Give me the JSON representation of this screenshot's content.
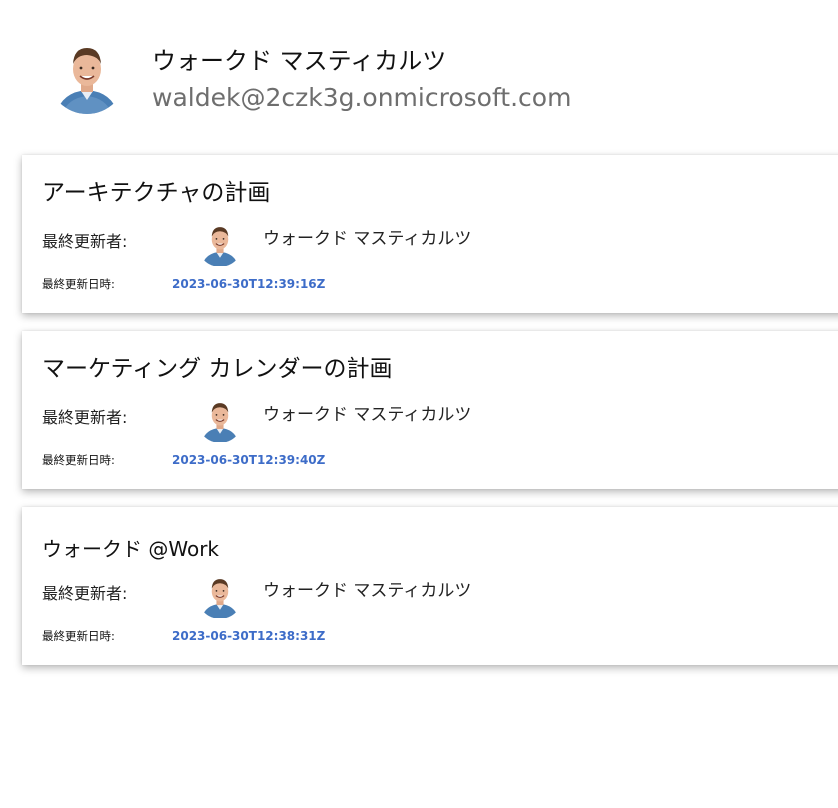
{
  "profile": {
    "name": "ウォークド マスティカルツ",
    "email": "waldek@2czk3g.onmicrosoft.com",
    "avatar_icon": "person-photo-avatar"
  },
  "labels": {
    "modified_by": "最終更新者:",
    "modified_at": "最終更新日時:"
  },
  "documents": [
    {
      "title": "アーキテクチャの計画",
      "modified_by": "ウォークド マスティカルツ",
      "modified_at": "2023-06-30T12:39:16Z"
    },
    {
      "title": "マーケティング カレンダーの計画",
      "modified_by": "ウォークド マスティカルツ",
      "modified_at": "2023-06-30T12:39:40Z"
    },
    {
      "title": "ウォークド @Work",
      "modified_by": "ウォークド マスティカルツ",
      "modified_at": "2023-06-30T12:38:31Z"
    }
  ],
  "colors": {
    "date_accent": "#3d6cc8",
    "email_gray": "#6e6e6e"
  }
}
